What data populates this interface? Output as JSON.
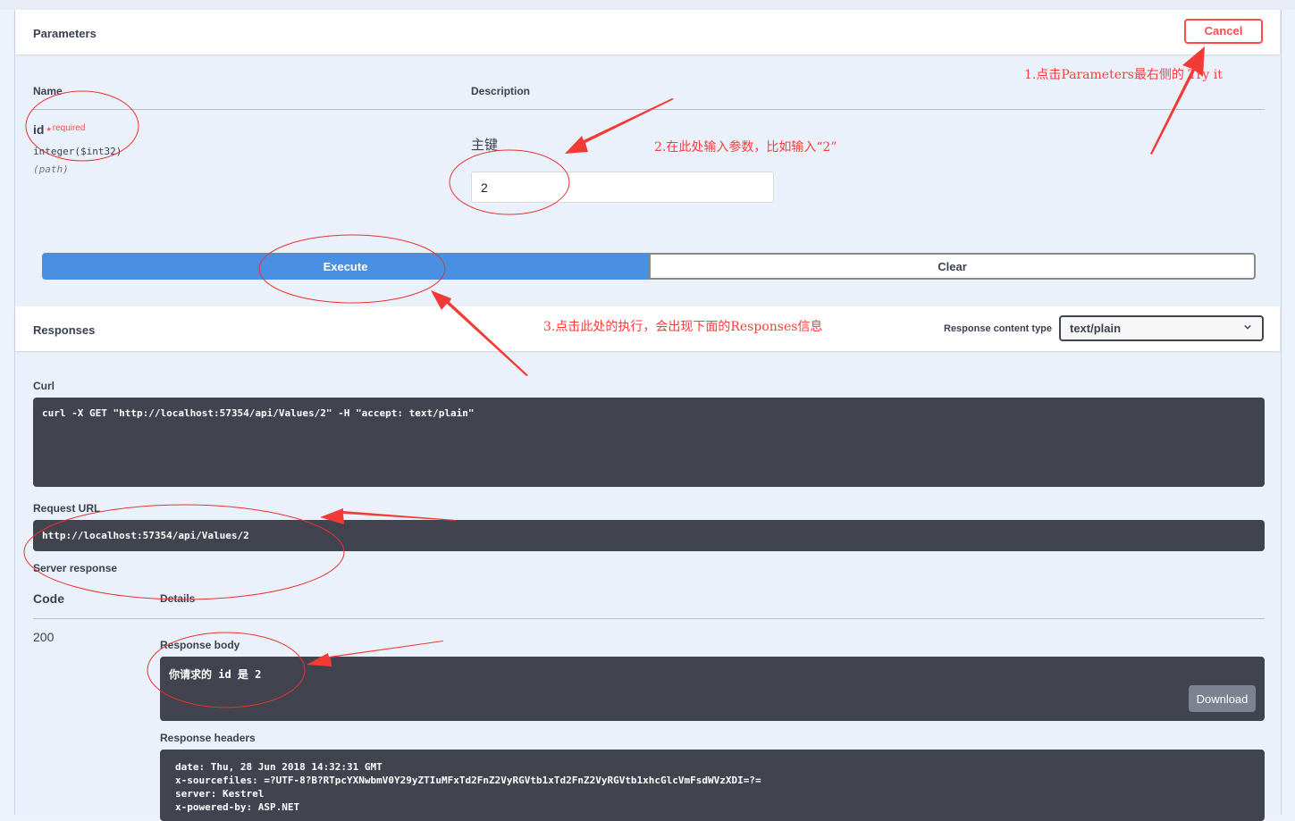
{
  "parameters": {
    "title": "Parameters",
    "cancel_label": "Cancel",
    "columns": {
      "name": "Name",
      "description": "Description"
    },
    "param": {
      "name": "id",
      "required_star": "*",
      "required_label": "required",
      "type": "integer($int32)",
      "location": "(path)",
      "description": "主键",
      "value": "2"
    },
    "execute_label": "Execute",
    "clear_label": "Clear"
  },
  "responses": {
    "title": "Responses",
    "content_type_label": "Response content type",
    "content_type_value": "text/plain",
    "curl_label": "Curl",
    "curl_command": "curl -X GET \"http://localhost:57354/api/Values/2\" -H \"accept: text/plain\"",
    "request_url_label": "Request URL",
    "request_url": "http://localhost:57354/api/Values/2",
    "server_response_label": "Server response",
    "code_header": "Code",
    "details_header": "Details",
    "code": "200",
    "response_body_label": "Response body",
    "response_body": "你请求的 id 是 2",
    "download_label": "Download",
    "response_headers_label": "Response headers",
    "headers": [
      "date: Thu, 28 Jun 2018 14:32:31 GMT",
      "x-sourcefiles: =?UTF-8?B?RTpcYXNwbmV0Y29yZTIuMFxTd2FnZ2VyRGVtb1xTd2FnZ2VyRGVtb1xhcGlcVmFsdWVzXDI=?=",
      "server: Kestrel",
      "x-powered-by: ASP.NET"
    ]
  },
  "annotations": {
    "step1": "1.点击Parameters最右侧的 Try it",
    "step2": "2.在此处输入参数，比如输入“2”",
    "step3": "3.点击此处的执行，会出现下面的Responses信息"
  },
  "colors": {
    "accent_blue": "#4990e2",
    "cancel_red": "#ff4c4c",
    "annotation_red": "#ff3b3b",
    "code_bg": "#41444e"
  },
  "icons": {
    "select_chevron": "chevron-down-icon"
  }
}
